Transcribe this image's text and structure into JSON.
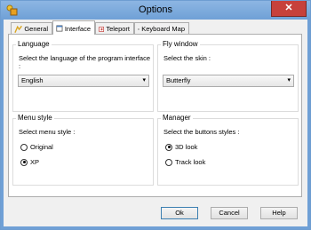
{
  "window": {
    "title": "Options",
    "close_glyph": "✕"
  },
  "tabs": [
    {
      "label": "General",
      "icon": "general-icon",
      "active": false
    },
    {
      "label": "Interface",
      "icon": "interface-icon",
      "active": true
    },
    {
      "label": "Teleport",
      "icon": "teleport-icon",
      "active": false
    },
    {
      "label": "Keyboard Map",
      "icon": "keyboard-icon",
      "active": false
    }
  ],
  "language": {
    "title": "Language",
    "label": "Select the language of the program interface :",
    "selected": "English"
  },
  "fly_window": {
    "title": "Fly window",
    "label": "Select the skin :",
    "selected": "Butterfly"
  },
  "menu_style": {
    "title": "Menu style",
    "label": "Select menu style :",
    "options": [
      {
        "label": "Original",
        "checked": false
      },
      {
        "label": "XP",
        "checked": true
      }
    ]
  },
  "manager": {
    "title": "Manager",
    "label": "Select the buttons styles :",
    "options": [
      {
        "label": "3D look",
        "checked": true
      },
      {
        "label": "Track look",
        "checked": false
      }
    ]
  },
  "buttons": {
    "ok": "Ok",
    "cancel": "Cancel",
    "help": "Help"
  },
  "colors": {
    "title_bar": "#6fa0d6",
    "close_button": "#c7413b",
    "panel_bg": "#ffffff",
    "dialog_bg": "#f0f0f0"
  }
}
